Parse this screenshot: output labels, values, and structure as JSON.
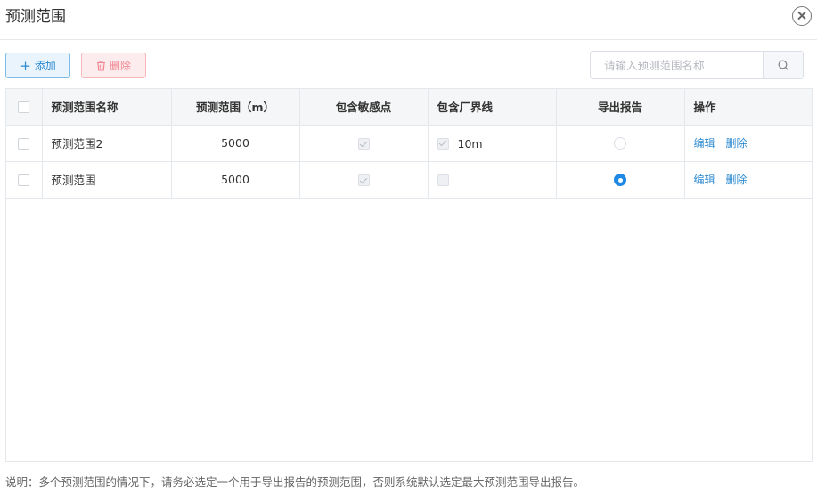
{
  "dialog": {
    "title": "预测范围"
  },
  "toolbar": {
    "add_label": "添加",
    "delete_label": "删除"
  },
  "search": {
    "placeholder": "请输入预测范围名称",
    "value": ""
  },
  "table": {
    "headers": [
      "预测范围名称",
      "预测范围（m）",
      "包含敏感点",
      "包含厂界线",
      "导出报告",
      "操作"
    ],
    "rows": [
      {
        "name": "预测范围2",
        "range": "5000",
        "include_sensitive": true,
        "include_fence": true,
        "fence_distance": "10m",
        "export_selected": false,
        "edit_label": "编辑",
        "delete_label": "删除"
      },
      {
        "name": "预测范围",
        "range": "5000",
        "include_sensitive": true,
        "include_fence": false,
        "fence_distance": "",
        "export_selected": true,
        "edit_label": "编辑",
        "delete_label": "删除"
      }
    ]
  },
  "note": "说明：多个预测范围的情况下，请务必选定一个用于导出报告的预测范围，否则系统默认选定最大预测范围导出报告。",
  "colors": {
    "accent": "#1e88e5",
    "link": "#2b8ad1",
    "danger": "#f08591"
  },
  "icons": {
    "close": "close-circle-icon",
    "add": "plus-icon",
    "delete": "trash-icon",
    "search": "search-icon"
  }
}
